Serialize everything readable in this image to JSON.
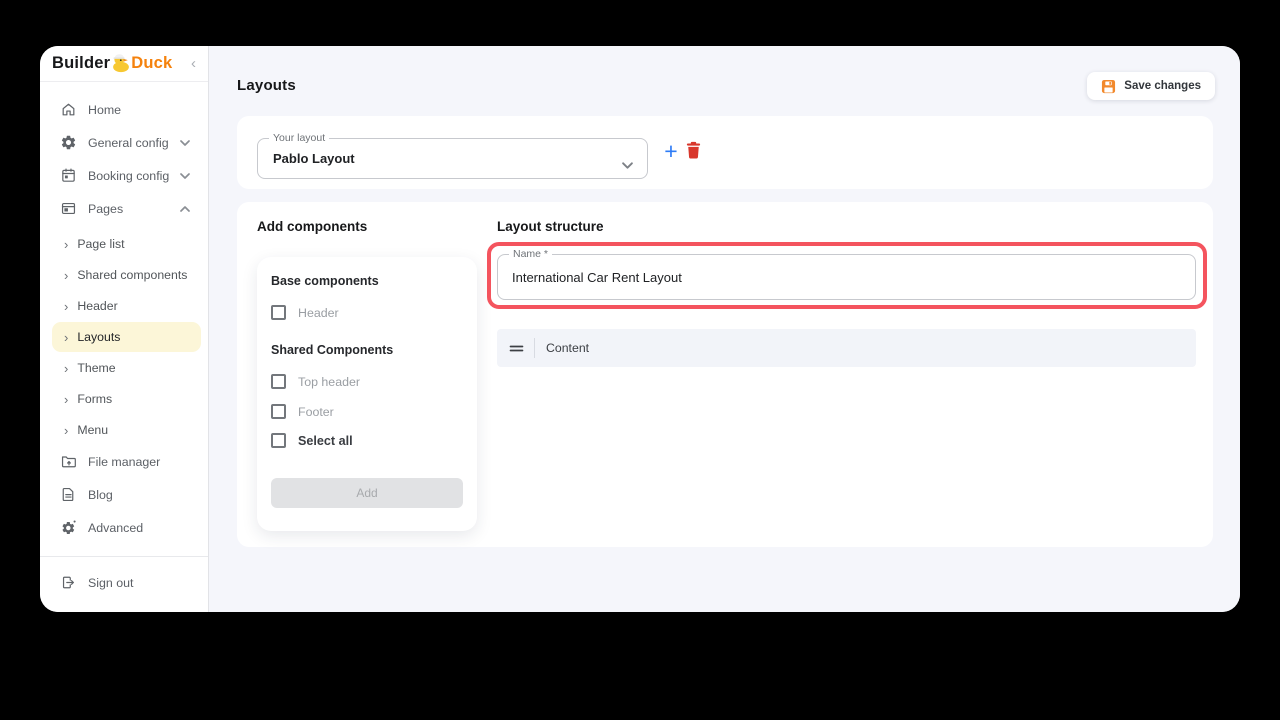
{
  "app": {
    "logo_part1": "Builder",
    "logo_part2": "Duck",
    "colors": {
      "brand_orange": "#f5820d",
      "active_item_yellow": "#fcf6d8",
      "highlight_red": "#f4545e",
      "plus_blue": "#2e7cf6",
      "trash_red": "#d8372c",
      "save_icon_orange": "#f2892c"
    }
  },
  "icons": {
    "collapse": "‹",
    "chevron_right": "›",
    "plus": "+"
  },
  "sidebar": {
    "items_top": [
      {
        "label": "Home",
        "icon": "home-icon"
      },
      {
        "label": "General config",
        "icon": "gear-icon",
        "state": "collapsed"
      },
      {
        "label": "Booking config",
        "icon": "calendar-icon",
        "state": "collapsed"
      },
      {
        "label": "Pages",
        "icon": "pages-icon",
        "state": "expanded"
      }
    ],
    "pages_children": [
      "Page list",
      "Shared components",
      "Header",
      "Layouts",
      "Theme",
      "Forms",
      "Menu"
    ],
    "active_child": "Layouts",
    "items_bottom": [
      {
        "label": "File manager",
        "icon": "file-manager-icon"
      },
      {
        "label": "Blog",
        "icon": "blog-icon"
      },
      {
        "label": "Advanced",
        "icon": "advanced-gear-icon"
      }
    ],
    "sign_out_label": "Sign out"
  },
  "header": {
    "title": "Layouts",
    "save_button_label": "Save changes"
  },
  "layout_selector": {
    "label": "Your layout",
    "value": "Pablo Layout"
  },
  "add_components": {
    "title": "Add components",
    "base_group_title": "Base components",
    "base_options": [
      "Header"
    ],
    "shared_group_title": "Shared Components",
    "shared_options": [
      "Top header",
      "Footer"
    ],
    "select_all_label": "Select all",
    "add_button_label": "Add",
    "add_button_enabled": false
  },
  "layout_structure": {
    "title": "Layout structure",
    "name_field": {
      "label": "Name *",
      "value": "International Car Rent Layout",
      "highlighted": true
    },
    "rows": [
      {
        "label": "Content"
      }
    ]
  }
}
